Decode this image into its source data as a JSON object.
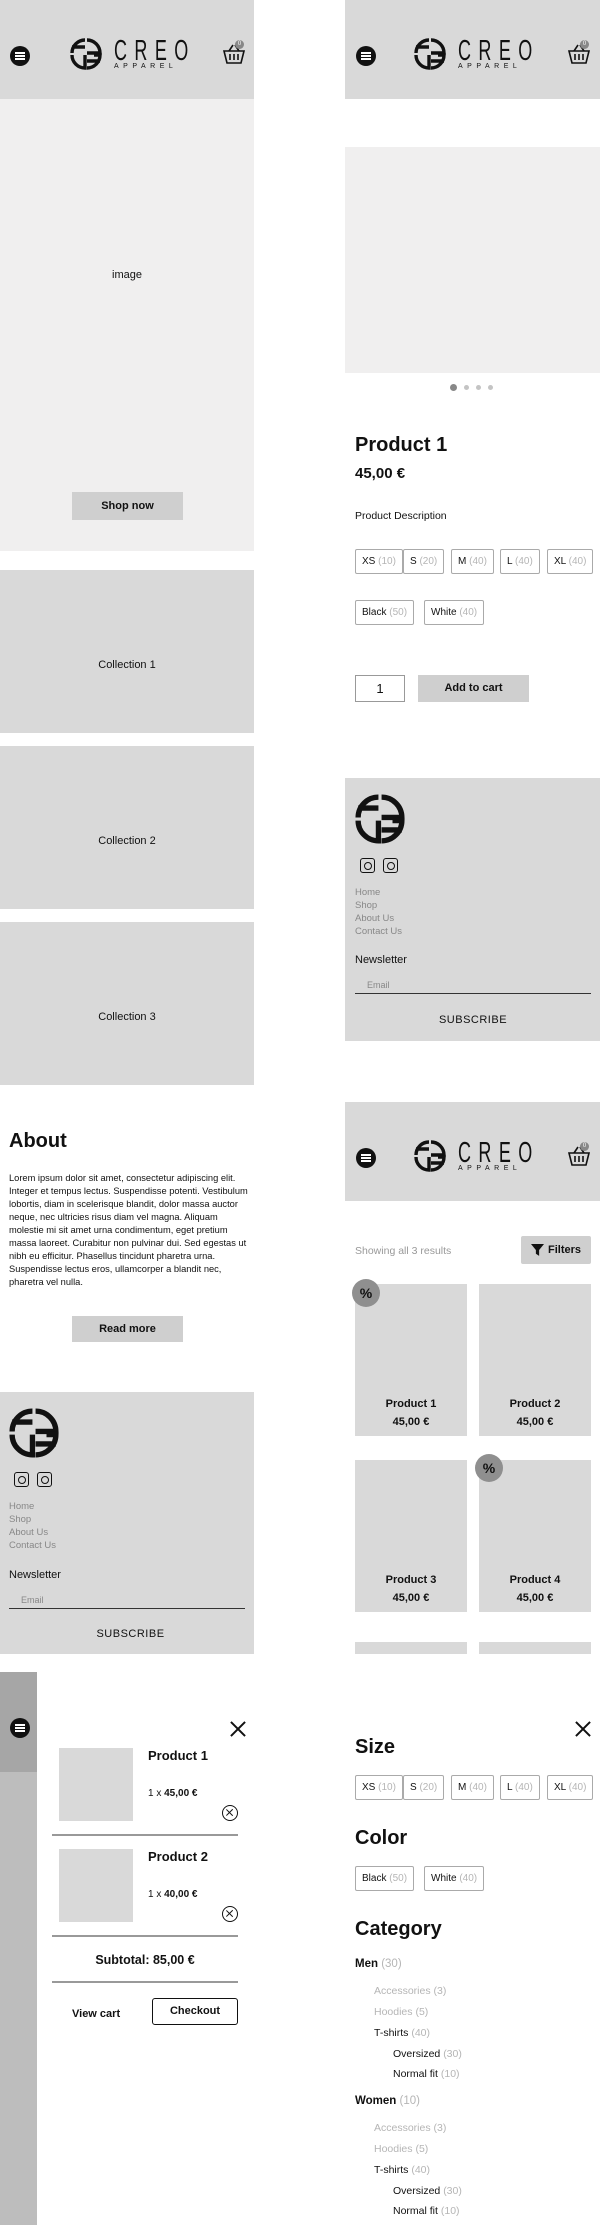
{
  "brand": {
    "name": "CREO",
    "sub": "APPAREL"
  },
  "cart_badge": "0",
  "home": {
    "hero_image_label": "image",
    "shop_now": "Shop now",
    "collections": [
      "Collection 1",
      "Collection 2",
      "Collection 3"
    ],
    "about_title": "About",
    "about_text": "Lorem ipsum dolor sit amet, consectetur adipiscing elit. Integer et tempus lectus. Suspendisse potenti. Vestibulum lobortis, diam in scelerisque blandit, dolor massa auctor neque, nec ultricies risus diam vel magna. Aliquam molestie mi sit amet urna condimentum, eget pretium massa laoreet. Curabitur non pulvinar dui. Sed egestas ut nibh eu efficitur. Phasellus tincidunt pharetra urna. Suspendisse lectus eros, ullamcorper a blandit nec, pharetra vel nulla.",
    "read_more": "Read more"
  },
  "footer": {
    "links": [
      "Home",
      "Shop",
      "About Us",
      "Contact Us"
    ],
    "newsletter": "Newsletter",
    "email_placeholder": "Email",
    "subscribe": "SUBSCRIBE"
  },
  "product": {
    "name": "Product 1",
    "price": "45,00 €",
    "description": "Product Description",
    "sizes": [
      {
        "label": "XS",
        "count": "(10)"
      },
      {
        "label": "S",
        "count": "(20)"
      },
      {
        "label": "M",
        "count": "(40)"
      },
      {
        "label": "L",
        "count": "(40)"
      },
      {
        "label": "XL",
        "count": "(40)"
      }
    ],
    "colors": [
      {
        "label": "Black",
        "count": "(50)"
      },
      {
        "label": "White",
        "count": "(40)"
      }
    ],
    "quantity": "1",
    "add_to_cart": "Add to cart",
    "slide_count": 4,
    "active_slide": 1
  },
  "shop": {
    "results": "Showing all 3 results",
    "filters": "Filters",
    "discount_badge": "%",
    "products": [
      {
        "name": "Product 1",
        "price": "45,00 €",
        "sale": true
      },
      {
        "name": "Product 2",
        "price": "45,00 €",
        "sale": false
      },
      {
        "name": "Product 3",
        "price": "45,00 €",
        "sale": false
      },
      {
        "name": "Product 4",
        "price": "45,00 €",
        "sale": true
      }
    ]
  },
  "cart": {
    "items": [
      {
        "name": "Product 1",
        "qty": "1 x",
        "price": "45,00 €"
      },
      {
        "name": "Product 2",
        "qty": "1 x",
        "price": "40,00 €"
      }
    ],
    "subtotal": "Subtotal: 85,00 €",
    "view_cart": "View cart",
    "checkout": "Checkout"
  },
  "filters_panel": {
    "size_title": "Size",
    "color_title": "Color",
    "category_title": "Category",
    "categories": [
      {
        "name": "Men",
        "count": "(30)",
        "children": [
          {
            "name": "Accessories",
            "count": "(3)"
          },
          {
            "name": "Hoodies",
            "count": "(5)"
          },
          {
            "name": "T-shirts",
            "count": "(40)",
            "children": [
              {
                "name": "Oversized",
                "count": "(30)"
              },
              {
                "name": "Normal fit",
                "count": "(10)"
              }
            ]
          }
        ]
      },
      {
        "name": "Women",
        "count": "(10)",
        "children": [
          {
            "name": "Accessories",
            "count": "(3)"
          },
          {
            "name": "Hoodies",
            "count": "(5)"
          },
          {
            "name": "T-shirts",
            "count": "(40)",
            "children": [
              {
                "name": "Oversized",
                "count": "(30)"
              },
              {
                "name": "Normal fit",
                "count": "(10)"
              }
            ]
          }
        ]
      }
    ]
  },
  "colors": {
    "panel_gray": "#d9d9d9",
    "hero_light": "#f0efef",
    "button_gray": "#cfcfcf",
    "count_gray": "#b5b5b5"
  }
}
